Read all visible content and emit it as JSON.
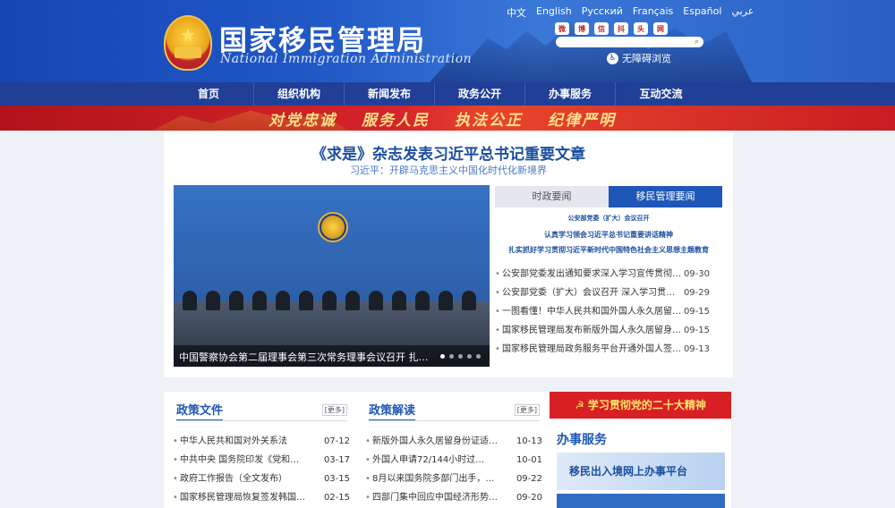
{
  "header": {
    "title": "国家移民管理局",
    "subtitle": "National Immigration Administration",
    "languages": [
      "中文",
      "English",
      "Русский",
      "Français",
      "Español",
      "عربي"
    ],
    "socials": [
      "微",
      "博",
      "信",
      "抖",
      "头",
      "网"
    ],
    "accessibility": "无障碍浏览"
  },
  "nav": [
    "首页",
    "组织机构",
    "新闻发布",
    "政务公开",
    "办事服务",
    "互动交流"
  ],
  "banner": {
    "slogans": [
      "对党忠诚",
      "服务人民",
      "执法公正",
      "纪律严明"
    ]
  },
  "main": {
    "headline": "《求是》杂志发表习近平总书记重要文章",
    "subhead": "习近平：开辟马克思主义中国化时代化新境界",
    "slide_caption": "中国警察协会第二届理事会第三次常务理事会议召开 扎实做好警察…",
    "tabs": [
      "时政要闻",
      "移民管理要闻"
    ],
    "feature": {
      "line1": "公安部党委（扩大）会议召开",
      "line2": "认真学习领会习近平总书记重要讲话精神",
      "line3": "扎实抓好学习贯彻习近平新时代中国特色社会主义思想主题教育"
    },
    "news": [
      {
        "title": "公安部党委发出通知要求深入学习宣传贯彻习近…",
        "date": "09-30"
      },
      {
        "title": "公安部党委（扩大）会议召开 深入学习贯彻习…",
        "date": "09-29"
      },
      {
        "title": "一图看懂！中华人民共和国外国人永久居留身份…",
        "date": "09-15"
      },
      {
        "title": "国家移民管理局发布新版外国人永久居留身份证",
        "date": "09-15"
      },
      {
        "title": "国家移民管理局政务服务平台开通外国人签证证…",
        "date": "09-13"
      }
    ]
  },
  "policy_docs": {
    "title": "政策文件",
    "more": "[更多]",
    "items": [
      {
        "title": "中华人民共和国对外关系法",
        "date": "07-12"
      },
      {
        "title": "中共中央 国务院印发《党和国…",
        "date": "03-17"
      },
      {
        "title": "政府工作报告（全文发布）",
        "date": "03-15"
      },
      {
        "title": "国家移民管理局恢复签发韩国公…",
        "date": "02-15"
      }
    ]
  },
  "policy_interp": {
    "title": "政策解读",
    "more": "[更多]",
    "items": [
      {
        "title": "新版外国人永久居留身份证适配…",
        "date": "10-13"
      },
      {
        "title": "外国人申请72/144小时过…",
        "date": "10-01"
      },
      {
        "title": "8月以来国务院多部门出手，看…",
        "date": "09-22"
      },
      {
        "title": "四部门集中回应中国经济形势，…",
        "date": "09-20"
      }
    ]
  },
  "right": {
    "study_banner": "学习贯彻党的二十大精神",
    "services_title": "办事服务",
    "platform": "移民出入境网上办事平台"
  },
  "colors": {
    "primary": "#1f57b8",
    "header_blue": "#2058c6",
    "nav": "#213f96",
    "red": "#d71f24"
  }
}
